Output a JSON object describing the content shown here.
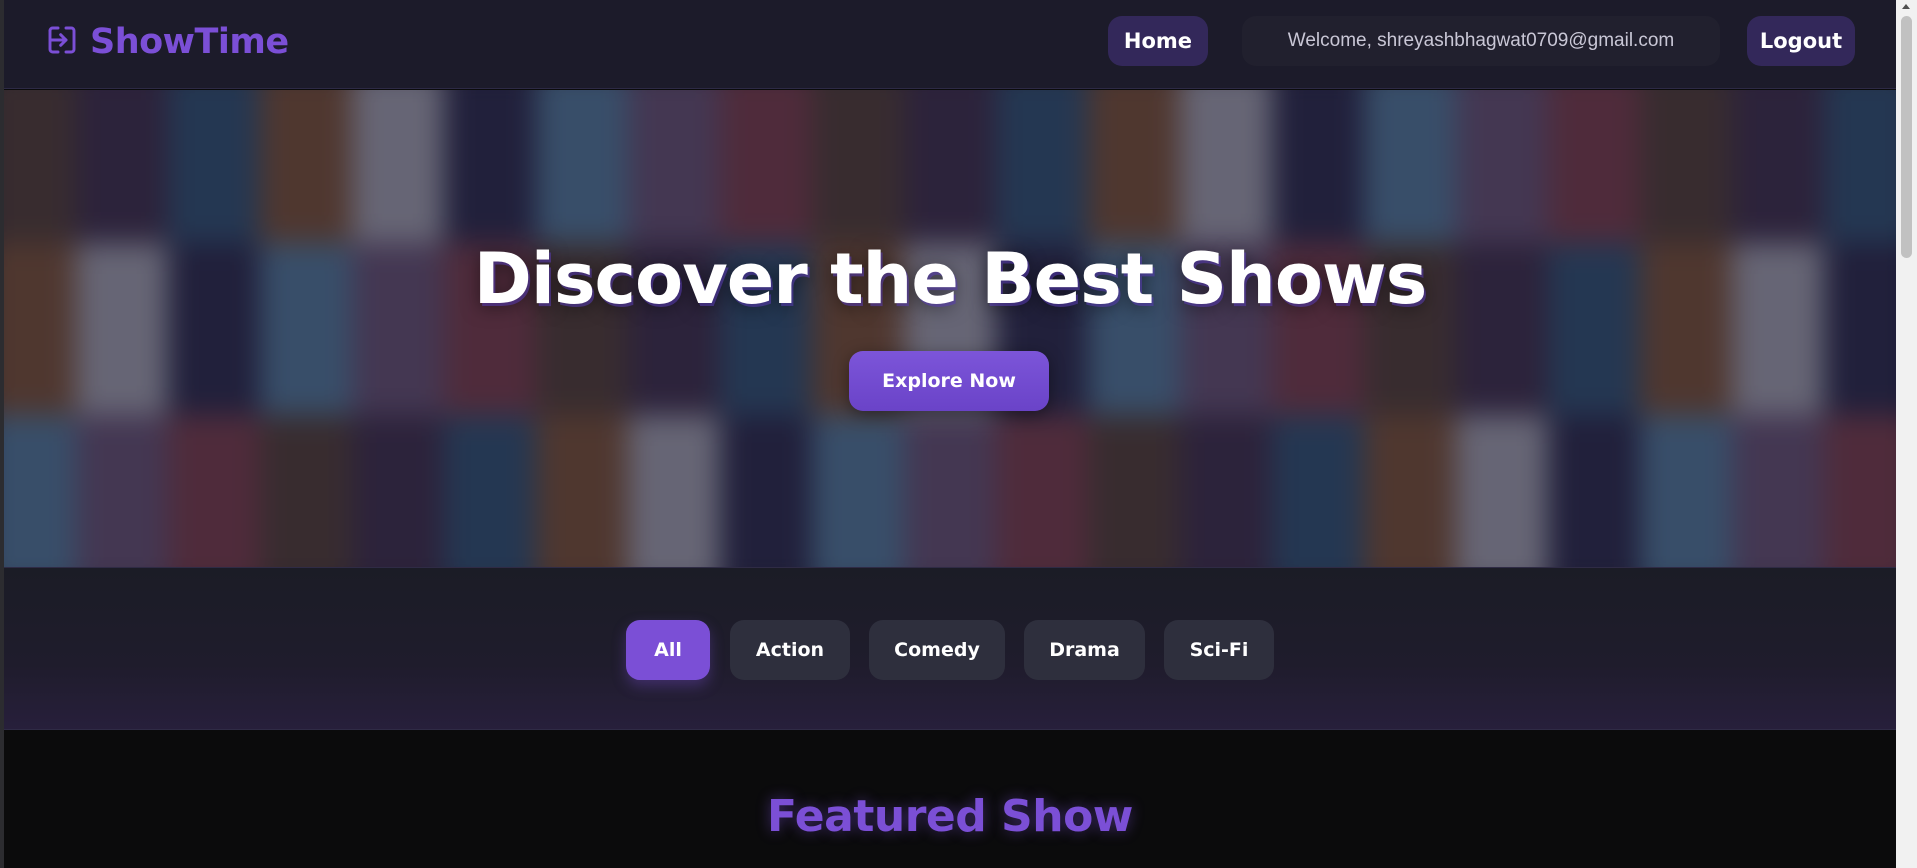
{
  "brand": {
    "name": "ShowTime",
    "icon": "login-icon"
  },
  "nav": {
    "home_label": "Home",
    "welcome_text": "Welcome, shreyashbhagwat0709@gmail.com",
    "logout_label": "Logout"
  },
  "hero": {
    "title": "Discover the Best Shows",
    "cta_label": "Explore Now"
  },
  "filters": [
    {
      "label": "All",
      "active": true
    },
    {
      "label": "Action",
      "active": false
    },
    {
      "label": "Comedy",
      "active": false
    },
    {
      "label": "Drama",
      "active": false
    },
    {
      "label": "Sci-Fi",
      "active": false
    }
  ],
  "featured": {
    "title": "Featured Show"
  },
  "colors": {
    "accent": "#7b4fd6",
    "nav_bg": "#1c1b2a",
    "chip_bg": "#2e2f3d"
  }
}
